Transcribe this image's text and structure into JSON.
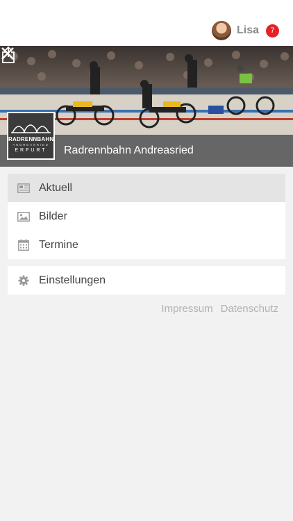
{
  "user": {
    "name": "Lisa",
    "badge_count": "7",
    "avatar_icon": "user-avatar"
  },
  "club": {
    "name": "Radrennbahn Andreasried",
    "logo_line1": "RADRENNBAHN",
    "logo_line2": "ANDREASRIED",
    "logo_line3": "ERFURT"
  },
  "header_icons": {
    "share": "share-icon",
    "close": "close-icon"
  },
  "menu": {
    "items": [
      {
        "label": "Aktuell",
        "icon": "newspaper-icon",
        "active": true
      },
      {
        "label": "Bilder",
        "icon": "image-icon",
        "active": false
      },
      {
        "label": "Termine",
        "icon": "calendar-icon",
        "active": false
      }
    ],
    "settings": {
      "label": "Einstellungen",
      "icon": "gear-icon"
    }
  },
  "footer": {
    "impressum": "Impressum",
    "datenschutz": "Datenschutz"
  },
  "colors": {
    "badge": "#e32127",
    "header_bar": "#5a5a5a",
    "active_item": "#e4e4e4",
    "background": "#f2f2f2"
  }
}
